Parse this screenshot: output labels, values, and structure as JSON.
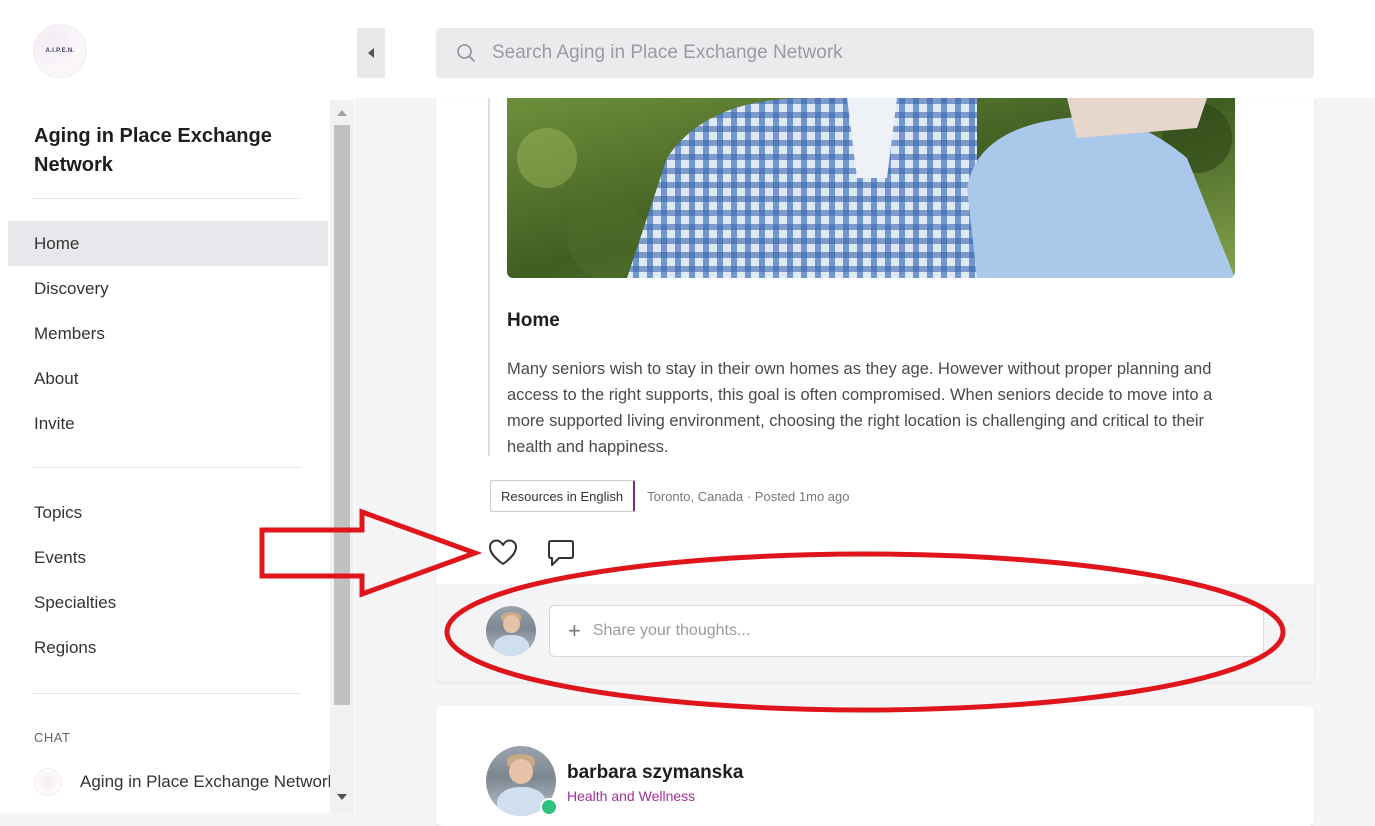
{
  "sidebar": {
    "logo_text": "A.I.P.E.N.",
    "network_title": "Aging in Place Exchange Network",
    "nav_primary": [
      {
        "label": "Home",
        "active": true
      },
      {
        "label": "Discovery"
      },
      {
        "label": "Members"
      },
      {
        "label": "About"
      },
      {
        "label": "Invite"
      }
    ],
    "nav_secondary": [
      {
        "label": "Topics"
      },
      {
        "label": "Events"
      },
      {
        "label": "Specialties"
      },
      {
        "label": "Regions"
      }
    ],
    "chat_label": "CHAT",
    "chat_item": "Aging in Place Exchange Network"
  },
  "search": {
    "placeholder": "Search Aging in Place Exchange Network",
    "icon": "search-icon"
  },
  "post": {
    "title": "Home",
    "body": "Many seniors wish to stay in their own homes as they age. However without proper planning and access to the right supports, this goal is often compromised. When seniors decide to move into a more supported living environment, choosing the right location is challenging and critical to their health and happiness.",
    "topic": "Resources in English",
    "meta": "Toronto, Canada ·  Posted 1mo ago",
    "comment_placeholder": "Share your thoughts..."
  },
  "next_post": {
    "author": "barbara szymanska",
    "subtitle": "Health and Wellness"
  },
  "colors": {
    "annotation_red": "#e0151b",
    "accent_purple": "#a0309a",
    "online_green": "#2ec27e"
  }
}
